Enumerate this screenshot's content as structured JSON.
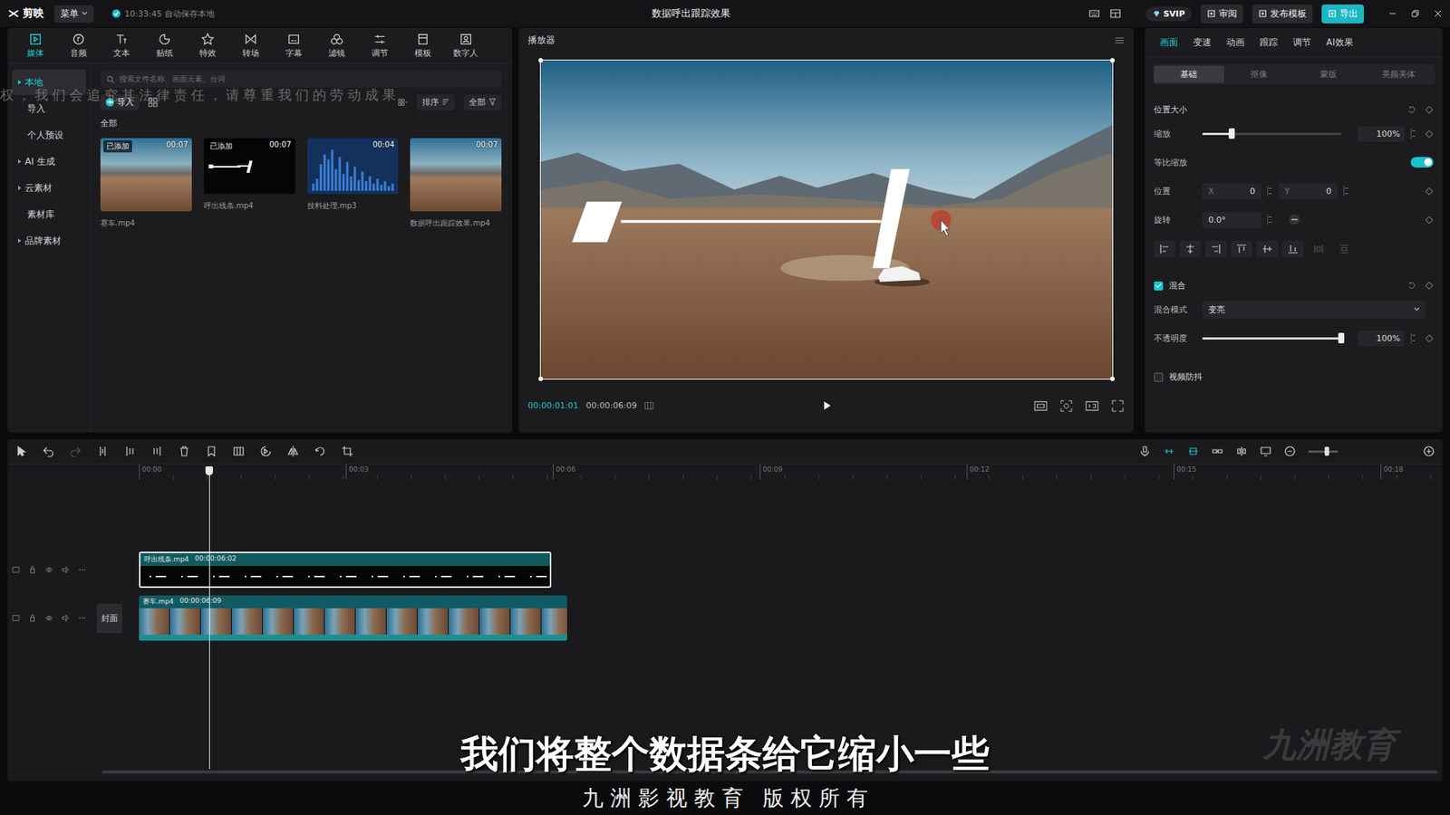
{
  "app": {
    "logo": "剪映",
    "menu": "菜单",
    "autosave": "10:33:45 自动保存本地",
    "title": "数据呼出跟踪效果",
    "svip": "SVIP",
    "actions": [
      {
        "label": "审阅",
        "kind": "plain"
      },
      {
        "label": "发布模板",
        "kind": "plain"
      },
      {
        "label": "导出",
        "kind": "primary"
      }
    ]
  },
  "toolbar": [
    {
      "label": "媒体",
      "selected": true
    },
    {
      "label": "音频",
      "selected": false
    },
    {
      "label": "文本",
      "selected": false
    },
    {
      "label": "贴纸",
      "selected": false
    },
    {
      "label": "特效",
      "selected": false
    },
    {
      "label": "转场",
      "selected": false
    },
    {
      "label": "字幕",
      "selected": false
    },
    {
      "label": "滤镜",
      "selected": false
    },
    {
      "label": "调节",
      "selected": false
    },
    {
      "label": "模板",
      "selected": false
    },
    {
      "label": "数字人",
      "selected": false
    }
  ],
  "media": {
    "sidebar": [
      {
        "label": "本地",
        "selected": true,
        "expandable": true
      },
      {
        "label": "导入",
        "selected": false,
        "expandable": false
      },
      {
        "label": "个人预设",
        "selected": false,
        "expandable": false
      },
      {
        "label": "AI 生成",
        "selected": false,
        "expandable": true
      },
      {
        "label": "云素材",
        "selected": false,
        "expandable": true
      },
      {
        "label": "素材库",
        "selected": false,
        "expandable": false
      },
      {
        "label": "品牌素材",
        "selected": false,
        "expandable": true
      }
    ],
    "search_placeholder": "搜索文件名称、画面元素、台词",
    "import": "导入",
    "sort": "排序",
    "filter": "全部",
    "group": "全部",
    "items": [
      {
        "name": "赛车.mp4",
        "duration": "00:07",
        "badge": "已添加",
        "kind": "video"
      },
      {
        "name": "呼出线条.mp4",
        "duration": "00:07",
        "badge": "已添加",
        "kind": "lines"
      },
      {
        "name": "技料处理.mp3",
        "duration": "00:04",
        "badge": "",
        "kind": "audio"
      },
      {
        "name": "数据呼出跟踪效果.mp4",
        "duration": "00:07",
        "badge": "",
        "kind": "video"
      }
    ]
  },
  "notice_watermark": "权，我们会追究其法律责任，请尊重我们的劳动成果",
  "player": {
    "title": "播放器",
    "current": "00:00:01:01",
    "total": "00:00:06:09"
  },
  "properties": {
    "tabs": [
      {
        "label": "画面",
        "selected": true
      },
      {
        "label": "变速",
        "selected": false
      },
      {
        "label": "动画",
        "selected": false
      },
      {
        "label": "跟踪",
        "selected": false
      },
      {
        "label": "调节",
        "selected": false
      },
      {
        "label": "AI效果",
        "selected": false
      }
    ],
    "subtabs": [
      {
        "label": "基础",
        "selected": true
      },
      {
        "label": "抠像",
        "selected": false
      },
      {
        "label": "蒙版",
        "selected": false
      },
      {
        "label": "美颜美体",
        "selected": false
      }
    ],
    "position_size": {
      "title": "位置大小",
      "scale": {
        "label": "缩放",
        "level": 0.21,
        "value": "100%"
      },
      "uniform": {
        "label": "等比缩放",
        "on": true
      },
      "position": {
        "label": "位置",
        "x_label": "X",
        "x": "0",
        "y_label": "Y",
        "y": "0"
      },
      "rotation": {
        "label": "旋转",
        "value": "0.0°"
      }
    },
    "blend": {
      "title": "混合",
      "checked": true,
      "mode_label": "混合模式",
      "mode": "变亮",
      "opacity": {
        "label": "不透明度",
        "level": 1,
        "value": "100%"
      }
    },
    "stabilize": {
      "label": "视频防抖",
      "checked": false
    }
  },
  "timeline": {
    "ruler": [
      "00:00",
      "00:03",
      "00:06",
      "00:09",
      "00:12",
      "00:15",
      "00:18"
    ],
    "current": "00:00:01:01",
    "cover": "封面",
    "tracks": [
      {
        "name": "呼出线条.mp4",
        "duration": "00:00:06:02",
        "kind": "overlay",
        "selected": true
      },
      {
        "name": "赛车.mp4",
        "duration": "00:00:06:09",
        "kind": "main",
        "selected": false
      }
    ]
  },
  "caption": "我们将整个数据条给它缩小一些",
  "corner_watermark": "九洲教育",
  "footer": "九 洲 影 视 教 育   版 权 所 有"
}
